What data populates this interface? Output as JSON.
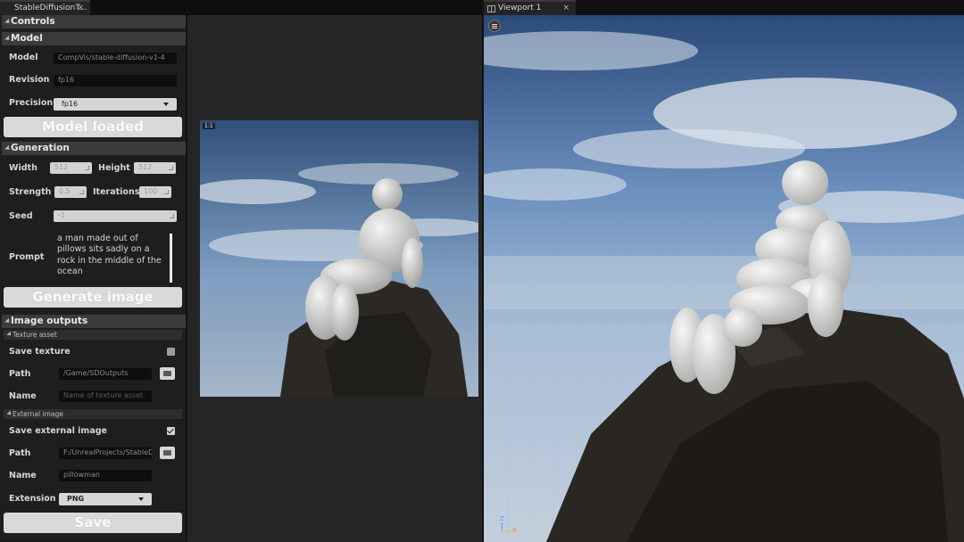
{
  "tabs": {
    "plugin": {
      "label": "StableDiffusionT...",
      "close": "×"
    },
    "viewport": {
      "label": "Viewport 1",
      "close": "×"
    }
  },
  "controls": {
    "title": "Controls",
    "model_section": {
      "title": "Model",
      "model_label": "Model",
      "model_value": "CompVis/stable-diffusion-v1-4",
      "revision_label": "Revision",
      "revision_value": "fp16",
      "precision_label": "Precision",
      "precision_value": "fp16",
      "load_button": "Model loaded"
    },
    "generation": {
      "title": "Generation",
      "width_label": "Width",
      "width_value": "512",
      "height_label": "Height",
      "height_value": "512",
      "strength_label": "Strength",
      "strength_value": "0.5",
      "iterations_label": "Iterations",
      "iterations_value": "100",
      "seed_label": "Seed",
      "seed_value": "-1",
      "prompt_label": "Prompt",
      "prompt_value": "a man made out of pillows sits sadly on a rock in the middle of the ocean",
      "generate_button": "Generate image"
    },
    "outputs": {
      "title": "Image outputs",
      "texture": {
        "title": "Texture asset",
        "save_label": "Save texture",
        "save_checked": false,
        "path_label": "Path",
        "path_value": "/Game/SDOutputs",
        "name_label": "Name",
        "name_placeholder": "Name of texture asset"
      },
      "external": {
        "title": "External image",
        "save_label": "Save external image",
        "save_checked": true,
        "path_label": "Path",
        "path_value": "F:/UnrealProjects/StableDiffu",
        "name_label": "Name",
        "name_value": "pillowman",
        "extension_label": "Extension",
        "extension_value": "PNG"
      },
      "save_button": "Save"
    }
  },
  "preview": {
    "badge": "1:1"
  },
  "viewport": {
    "axis_z": "Z",
    "axis_x": "X"
  },
  "colors": {
    "sky": "#5e86b6",
    "rock": "#2a2622",
    "figure": "#d9d9d6",
    "panel": "#1e1e1e"
  }
}
